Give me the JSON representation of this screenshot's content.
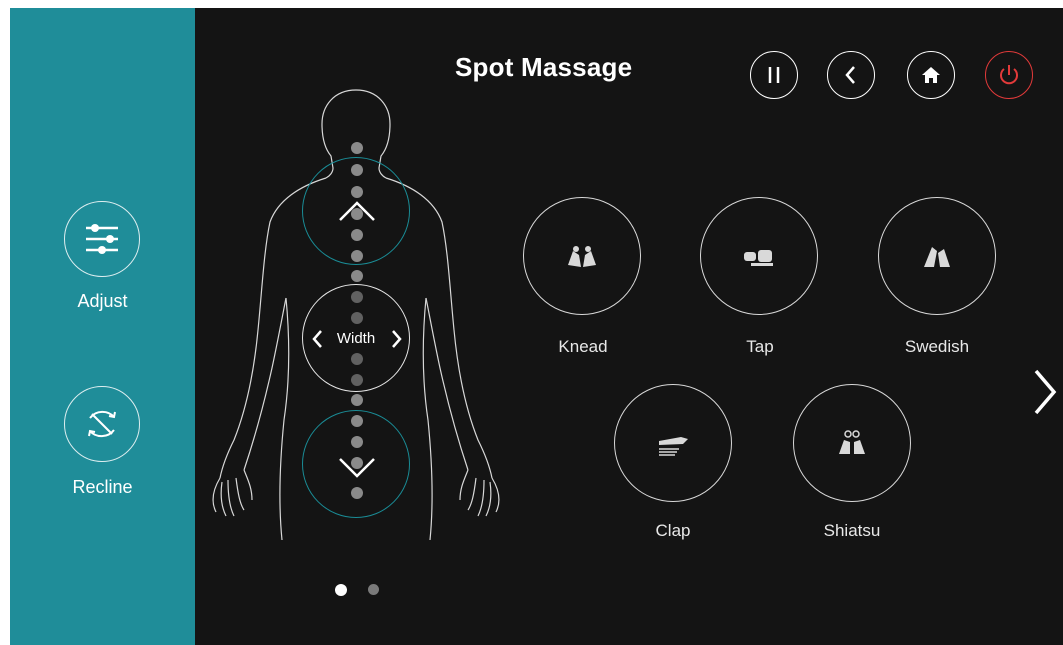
{
  "header": {
    "title": "Spot Massage"
  },
  "sidebar": {
    "adjust_label": "Adjust",
    "recline_label": "Recline"
  },
  "body_map": {
    "width_label": "Width"
  },
  "modes": [
    {
      "label": "Knead",
      "icon": "knead-hands-icon"
    },
    {
      "label": "Tap",
      "icon": "tap-hands-icon"
    },
    {
      "label": "Swedish",
      "icon": "swedish-hands-icon"
    },
    {
      "label": "Clap",
      "icon": "clap-hand-icon"
    },
    {
      "label": "Shiatsu",
      "icon": "shiatsu-hands-icon"
    }
  ],
  "pagination": {
    "current_page": 1,
    "total_pages": 2
  },
  "colors": {
    "sidebar": "#1f8d99",
    "background": "#141414",
    "power": "#e23a3a",
    "accent_ring": "#1a8c96"
  }
}
